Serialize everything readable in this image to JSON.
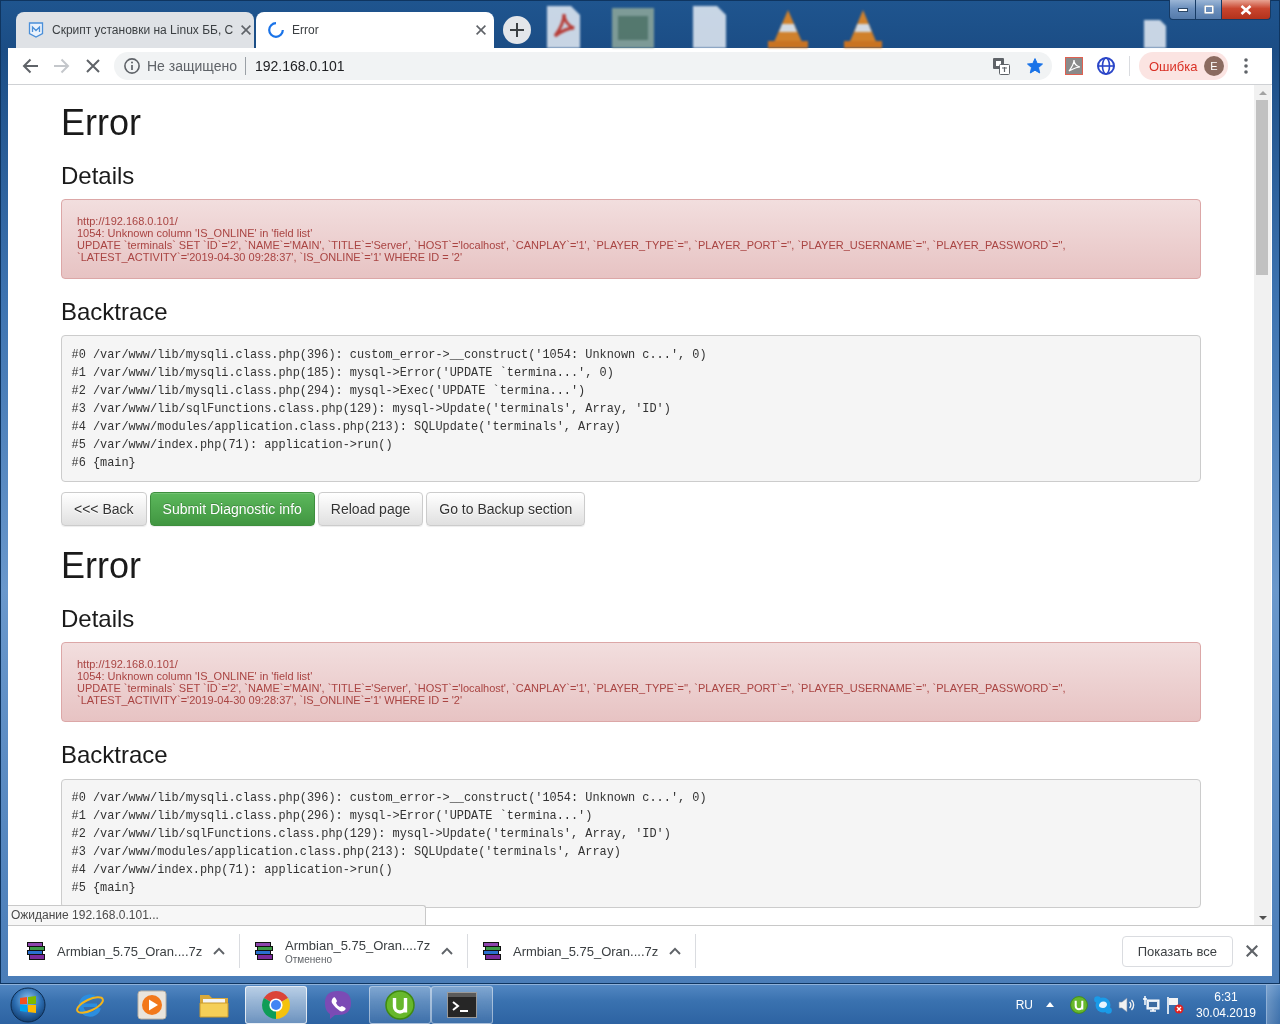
{
  "tabs": [
    {
      "title": "Скрипт установки на Linux ББ, С",
      "selected": false,
      "loading": false
    },
    {
      "title": "Error",
      "selected": true,
      "loading": true
    }
  ],
  "toolbar": {
    "can_go_forward": false,
    "loading": true,
    "security_label": "Не защищено",
    "url": "192.168.0.101",
    "bookmarked": true,
    "profile": {
      "status": "Ошибка",
      "initial": "E"
    }
  },
  "page": {
    "sections": [
      {
        "title": "Error",
        "details_heading": "Details",
        "details": [
          "http://192.168.0.101/",
          "1054: Unknown column 'IS_ONLINE' in 'field list'",
          "UPDATE `terminals` SET `ID`='2', `NAME`='MAIN', `TITLE`='Server', `HOST`='localhost', `CANPLAY`='1', `PLAYER_TYPE`='', `PLAYER_PORT`='', `PLAYER_USERNAME`='', `PLAYER_PASSWORD`='', `LATEST_ACTIVITY`='2019-04-30 09:28:37', `IS_ONLINE`='1' WHERE ID = '2'"
        ],
        "backtrace_heading": "Backtrace",
        "backtrace": [
          "#0 /var/www/lib/mysqli.class.php(396): custom_error->__construct('1054: Unknown c...', 0)",
          "#1 /var/www/lib/mysqli.class.php(185): mysql->Error('UPDATE `termina...', 0)",
          "#2 /var/www/lib/mysqli.class.php(294): mysql->Exec('UPDATE `termina...')",
          "#3 /var/www/lib/sqlFunctions.class.php(129): mysql->Update('terminals', Array, 'ID')",
          "#4 /var/www/modules/application.class.php(213): SQLUpdate('terminals', Array)",
          "#5 /var/www/index.php(71): application->run()",
          "#6 {main}"
        ],
        "buttons": [
          {
            "label": "<<< Back",
            "kind": "default"
          },
          {
            "label": "Submit Diagnostic info",
            "kind": "success"
          },
          {
            "label": "Reload page",
            "kind": "default"
          },
          {
            "label": "Go to Backup section",
            "kind": "default"
          }
        ]
      },
      {
        "title": "Error",
        "details_heading": "Details",
        "details": [
          "http://192.168.0.101/",
          "1054: Unknown column 'IS_ONLINE' in 'field list'",
          "UPDATE `terminals` SET `ID`='2', `NAME`='MAIN', `TITLE`='Server', `HOST`='localhost', `CANPLAY`='1', `PLAYER_TYPE`='', `PLAYER_PORT`='', `PLAYER_USERNAME`='', `PLAYER_PASSWORD`='', `LATEST_ACTIVITY`='2019-04-30 09:28:37', `IS_ONLINE`='1' WHERE ID = '2'"
        ],
        "backtrace_heading": "Backtrace",
        "backtrace": [
          "#0 /var/www/lib/mysqli.class.php(396): custom_error->__construct('1054: Unknown c...', 0)",
          "#1 /var/www/lib/mysqli.class.php(296): mysql->Error('UPDATE `termina...')",
          "#2 /var/www/lib/sqlFunctions.class.php(129): mysql->Update('terminals', Array, 'ID')",
          "#3 /var/www/modules/application.class.php(213): SQLUpdate('terminals', Array)",
          "#4 /var/www/index.php(71): application->run()",
          "#5 {main}"
        ]
      }
    ]
  },
  "status_bubble": "Ожидание 192.168.0.101...",
  "downloads": {
    "items": [
      {
        "file": "Armbian_5.75_Oran....7z"
      },
      {
        "file": "Armbian_5.75_Oran....7z",
        "status": "Отменено"
      },
      {
        "file": "Armbian_5.75_Oran....7z"
      }
    ],
    "show_all": "Показать все"
  },
  "taskbar": {
    "apps": [
      {
        "running": false,
        "selected": false
      },
      {
        "running": false,
        "selected": false
      },
      {
        "running": false,
        "selected": false
      },
      {
        "running": true,
        "selected": true
      },
      {
        "running": false,
        "selected": false
      },
      {
        "running": true,
        "selected": false
      },
      {
        "running": true,
        "selected": false
      }
    ],
    "tray": {
      "language": "RU",
      "time": "6:31",
      "date": "30.04.2019"
    }
  }
}
